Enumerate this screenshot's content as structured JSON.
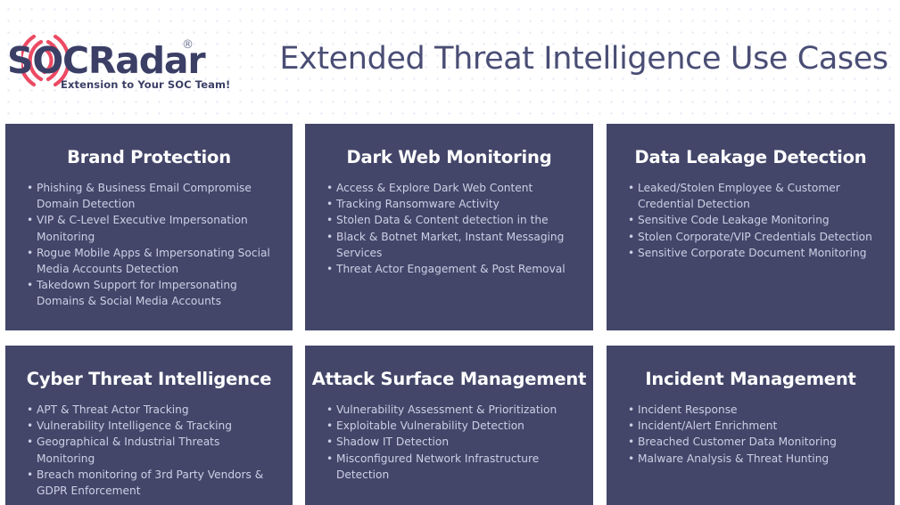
{
  "header": {
    "logo": {
      "brand_soc": "SOC",
      "brand_radar": "Radar",
      "registered_mark": "®",
      "tagline": "Extension to Your SOC Team!",
      "radar_color": "#ec4a63",
      "wordmark_color": "#3b3f66"
    },
    "title": "Extended Threat Intelligence Use Cases"
  },
  "theme": {
    "card_bg": "#434669",
    "card_title_color": "#ffffff",
    "card_text_color": "#ccd0e4",
    "page_bg": "#ffffff",
    "title_color": "#4a4e75",
    "dot_grid_color": "#c9d6ec"
  },
  "cards": [
    {
      "title": "Brand Protection",
      "items": [
        "Phishing & Business Email Compromise Domain Detection",
        "VIP & C-Level Executive Impersonation Monitoring",
        "Rogue Mobile Apps & Impersonating Social Media Accounts Detection",
        "Takedown Support for Impersonating Domains & Social Media Accounts"
      ]
    },
    {
      "title": "Dark Web Monitoring",
      "items": [
        "Access & Explore Dark Web Content",
        "Tracking Ransomware Activity",
        "Stolen Data & Content detection in the",
        "Black & Botnet Market, Instant Messaging Services",
        "Threat Actor Engagement & Post Removal"
      ]
    },
    {
      "title": "Data Leakage Detection",
      "items": [
        "Leaked/Stolen Employee & Customer Credential Detection",
        "Sensitive Code Leakage Monitoring",
        "Stolen Corporate/VIP Credentials Detection",
        "Sensitive Corporate Document Monitoring"
      ]
    },
    {
      "title": "Cyber Threat Intelligence",
      "items": [
        "APT & Threat Actor Tracking",
        "Vulnerability Intelligence & Tracking",
        "Geographical & Industrial Threats Monitoring",
        "Breach monitoring of 3rd Party Vendors & GDPR Enforcement"
      ]
    },
    {
      "title": "Attack Surface Management",
      "items": [
        "Vulnerability Assessment & Prioritization",
        "Exploitable Vulnerability Detection",
        "Shadow IT Detection",
        "Misconfigured Network Infrastructure Detection"
      ]
    },
    {
      "title": "Incident Management",
      "items": [
        "Incident Response",
        "Incident/Alert Enrichment",
        "Breached Customer Data Monitoring",
        "Malware Analysis & Threat Hunting"
      ]
    }
  ],
  "bullet_glyph": "•"
}
